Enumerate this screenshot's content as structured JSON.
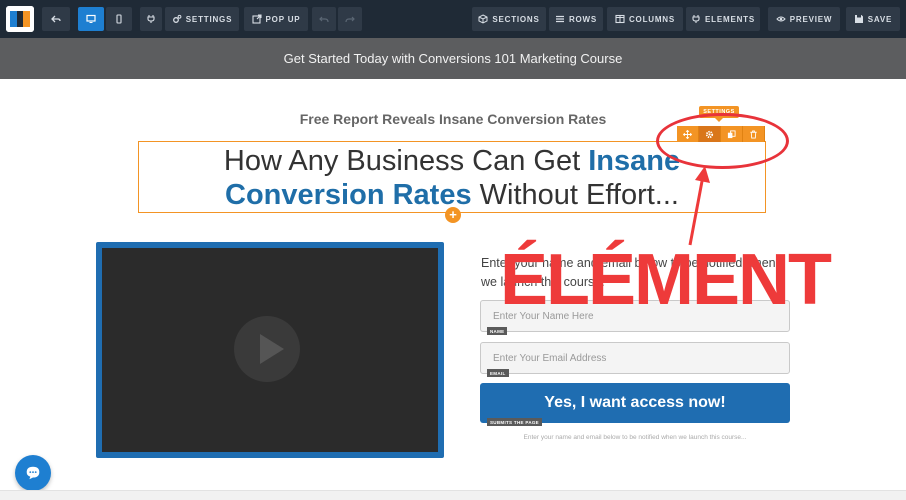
{
  "toolbar": {
    "settings_label": "SETTINGS",
    "popup_label": "POP UP",
    "sections_label": "SECTIONS",
    "rows_label": "ROWS",
    "columns_label": "COLUMNS",
    "elements_label": "ELEMENTS",
    "preview_label": "PREVIEW",
    "save_label": "SAVE"
  },
  "banner": {
    "text": "Get Started Today with Conversions 101 Marketing Course"
  },
  "page": {
    "subheadline": "Free Report Reveals Insane Conversion Rates",
    "headline_part1": "How Any Business Can Get ",
    "headline_highlight1": "Insane",
    "headline_highlight2": "Conversion Rates",
    "headline_part2": " Without Effort..."
  },
  "element_toolbar": {
    "settings_tag": "SETTINGS"
  },
  "form": {
    "intro": "Enter your name and email below to be notified when we launch this course.",
    "name_placeholder": "Enter Your Name Here",
    "name_tag": "NAME",
    "email_placeholder": "Enter Your Email Address",
    "email_tag": "EMAIL",
    "submit_label": "Yes, I want access now!",
    "submit_tag": "SUBMITS THE PAGE",
    "disclaimer": "Enter your name and email below to be notified when we launch this course..."
  },
  "annotation": {
    "label": "ÉLÉMENT",
    "color": "#ee3a3a"
  },
  "colors": {
    "toolbar_bg": "#1f2a36",
    "accent_blue": "#1e7fd1",
    "edit_orange": "#f39424",
    "brand_blue": "#1f6db1"
  }
}
